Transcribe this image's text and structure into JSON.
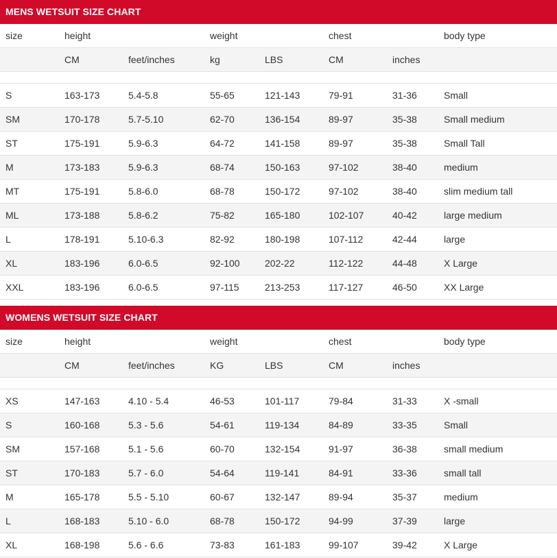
{
  "mens": {
    "title": "MENS WETSUIT SIZE CHART",
    "header": [
      "size",
      "height",
      "weight",
      "chest",
      "body type"
    ],
    "units": [
      "CM",
      "feet/inches",
      "kg",
      "LBS",
      "CM",
      "inches"
    ],
    "rows": [
      [
        "S",
        "163-173",
        "5.4-5.8",
        "55-65",
        "121-143",
        "79-91",
        "31-36",
        "Small"
      ],
      [
        "SM",
        "170-178",
        "5.7-5.10",
        "62-70",
        "136-154",
        "89-97",
        "35-38",
        "Small medium"
      ],
      [
        "ST",
        "175-191",
        "5.9-6.3",
        "64-72",
        "141-158",
        "89-97",
        "35-38",
        "Small Tall"
      ],
      [
        "M",
        "173-183",
        "5.9-6.3",
        "68-74",
        "150-163",
        "97-102",
        "38-40",
        "medium"
      ],
      [
        "MT",
        "175-191",
        "5.8-6.0",
        "68-78",
        "150-172",
        "97-102",
        "38-40",
        "slim medium tall"
      ],
      [
        "ML",
        "173-188",
        "5.8-6.2",
        "75-82",
        "165-180",
        "102-107",
        "40-42",
        "large medium"
      ],
      [
        "L",
        "178-191",
        "5.10-6.3",
        "82-92",
        "180-198",
        "107-112",
        "42-44",
        "large"
      ],
      [
        "XL",
        "183-196",
        "6.0-6.5",
        "92-100",
        "202-22",
        "112-122",
        "44-48",
        "X Large"
      ],
      [
        "XXL",
        "183-196",
        "6.0-6.5",
        "97-115",
        "213-253",
        "117-127",
        "46-50",
        "XX Large"
      ]
    ]
  },
  "womens": {
    "title": "WOMENS WETSUIT SIZE CHART",
    "header": [
      "size",
      "height",
      "weight",
      "chest",
      "body type"
    ],
    "units": [
      "CM",
      "feet/inches",
      "KG",
      "LBS",
      "CM",
      "inches"
    ],
    "rows": [
      [
        "XS",
        "147-163",
        "4.10 - 5.4",
        "46-53",
        "101-117",
        "79-84",
        "31-33",
        "X -small"
      ],
      [
        "S",
        "160-168",
        "5.3 - 5.6",
        "54-61",
        "119-134",
        "84-89",
        "33-35",
        "Small"
      ],
      [
        "SM",
        "157-168",
        "5.1 - 5.6",
        "60-70",
        "132-154",
        "91-97",
        "36-38",
        "small medium"
      ],
      [
        "ST",
        "170-183",
        "5.7 - 6.0",
        "54-64",
        "119-141",
        "84-91",
        "33-36",
        "small tall"
      ],
      [
        "M",
        "165-178",
        "5.5 - 5.10",
        "60-67",
        "132-147",
        "89-94",
        "35-37",
        "medium"
      ],
      [
        "L",
        "168-183",
        "5.10 - 6.0",
        "68-78",
        "150-172",
        "94-99",
        "37-39",
        "large"
      ],
      [
        "XL",
        "168-198",
        "5.6 - 6.6",
        "73-83",
        "161-183",
        "99-107",
        "39-42",
        "X Large"
      ]
    ]
  }
}
